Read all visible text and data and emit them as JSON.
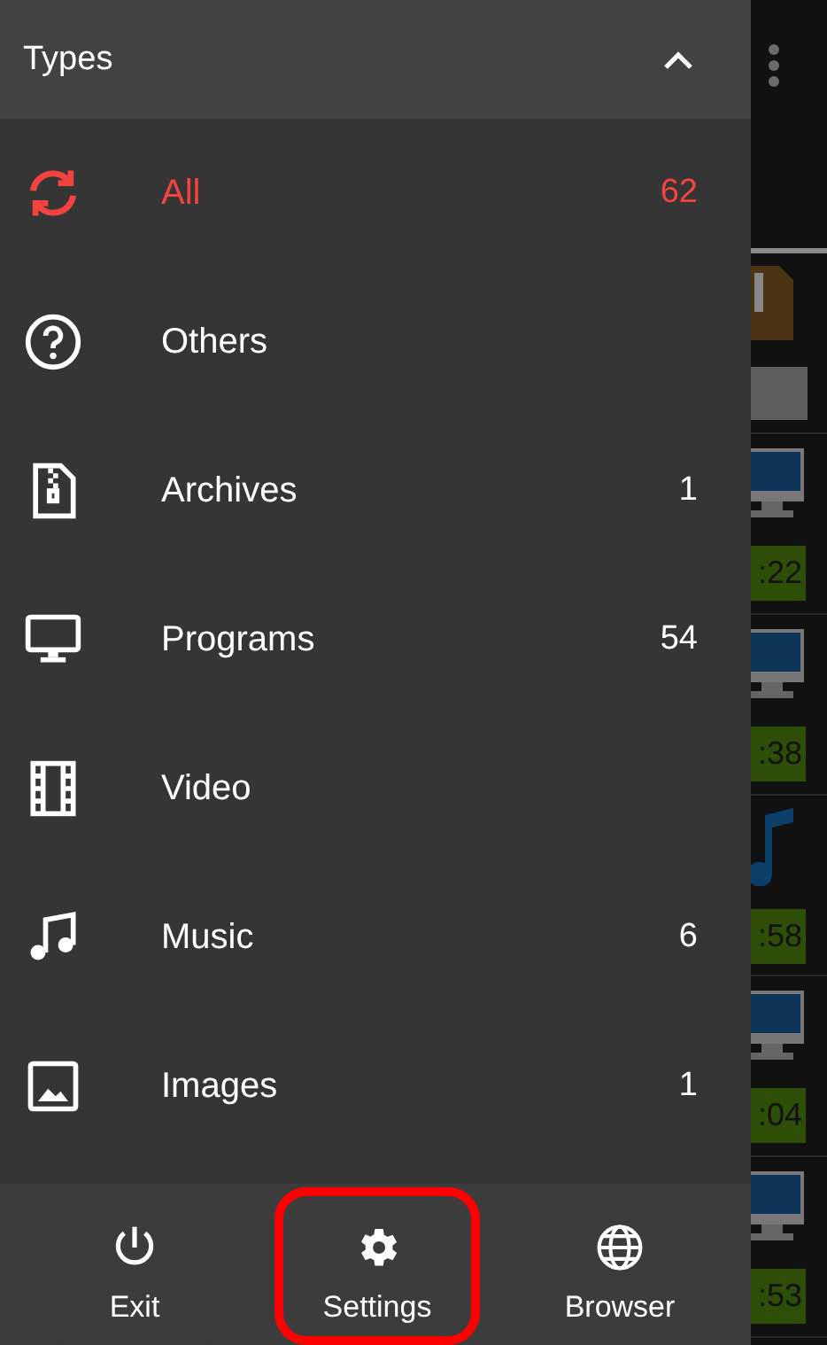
{
  "drawer": {
    "title": "Types",
    "expanded": true,
    "items": [
      {
        "kind": "all",
        "label": "All",
        "count": "62",
        "selected": true
      },
      {
        "kind": "others",
        "label": "Others",
        "selected": false
      },
      {
        "kind": "archives",
        "label": "Archives",
        "count": "1",
        "selected": false
      },
      {
        "kind": "programs",
        "label": "Programs",
        "count": "54",
        "selected": false
      },
      {
        "kind": "video",
        "label": "Video",
        "selected": false
      },
      {
        "kind": "music",
        "label": "Music",
        "count": "6",
        "selected": false
      },
      {
        "kind": "images",
        "label": "Images",
        "count": "1",
        "selected": false
      }
    ]
  },
  "bottom_bar": [
    {
      "kind": "exit",
      "label": "Exit",
      "highlighted": false
    },
    {
      "kind": "settings",
      "label": "Settings",
      "highlighted": true
    },
    {
      "kind": "browser",
      "label": "Browser",
      "highlighted": false
    }
  ],
  "background_list": [
    {
      "kind": "archive"
    },
    {
      "kind": "program",
      "time": ":22"
    },
    {
      "kind": "program",
      "time": ":38"
    },
    {
      "kind": "music",
      "time": ":58"
    },
    {
      "kind": "program",
      "time": ":04"
    },
    {
      "kind": "program",
      "time": ":53"
    }
  ]
}
